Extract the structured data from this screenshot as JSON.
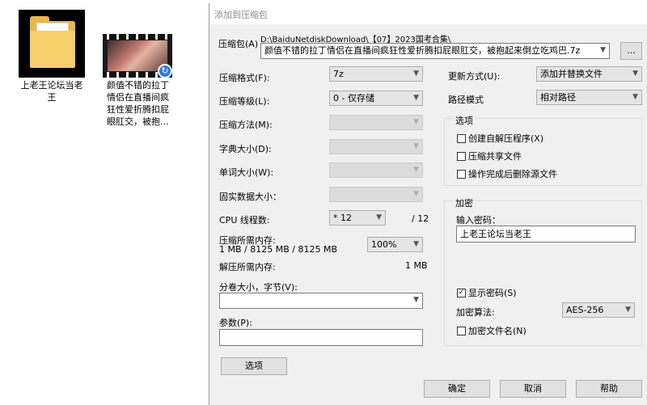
{
  "desktop": {
    "folder_label": "上老王论坛当老王",
    "video_label": "颜值不错的拉丁情侣在直播间疯狂性爱折腾扣屁眼肛交，被抱...",
    "video_badge_icon": "refresh-badge-icon"
  },
  "dialog": {
    "title": "添加到压缩包",
    "archive_label": "压缩包(A)",
    "archive_path": "D:\\BaiduNetdiskDownload\\【07】2023国考合集\\",
    "archive_name": "颜值不错的拉丁情侣在直播间疯狂性爱折腾扣屁眼肛交，被抱起来倒立吃鸡巴.7z",
    "browse_label": "...",
    "format_label": "压缩格式(F):",
    "format_value": "7z",
    "level_label": "压缩等级(L):",
    "level_value": "0 - 仅存储",
    "method_label": "压缩方法(M):",
    "dict_label": "字典大小(D):",
    "word_label": "单词大小(W):",
    "solid_label": "固实数据大小：",
    "cpu_label": "CPU 线程数:",
    "cpu_value": "* 12",
    "cpu_max": "/ 12",
    "mem_compress_label": "压缩所需内存:",
    "mem_compress_value": "1 MB / 8125 MB / 8125 MB",
    "mem_percent": "100%",
    "mem_decompress_label": "解压所需内存:",
    "mem_decompress_value": "1 MB",
    "split_label": "分卷大小，字节(V):",
    "split_value": "",
    "params_label": "参数(P):",
    "params_value": "",
    "options_button": "选项",
    "update_label": "更新方式(U):",
    "update_value": "添加并替换文件",
    "path_mode_label": "路径模式",
    "path_mode_value": "相对路径",
    "options_group": {
      "title": "选项",
      "items": [
        {
          "label": "创建自解压程序(X)",
          "checked": false
        },
        {
          "label": "压缩共享文件",
          "checked": false
        },
        {
          "label": "操作完成后删除源文件",
          "checked": false
        }
      ]
    },
    "encryption_group": {
      "title": "加密",
      "password_label": "输入密码：",
      "password_value": "上老王论坛当老王",
      "show_password_label": "显示密码(S)",
      "show_password_checked": true,
      "method_label": "加密算法:",
      "method_value": "AES-256",
      "encrypt_names_label": "加密文件名(N)",
      "encrypt_names_checked": false
    },
    "ok_button": "确定",
    "cancel_button": "取消",
    "help_button": "帮助"
  }
}
